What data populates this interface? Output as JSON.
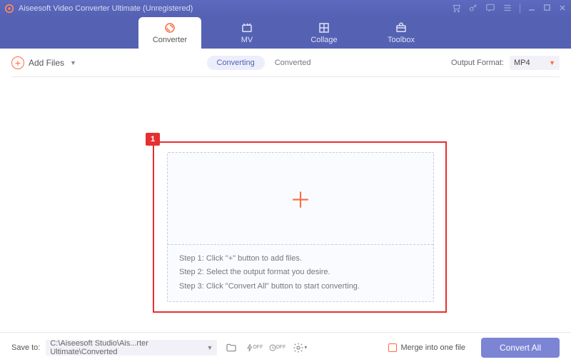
{
  "titlebar": {
    "title": "Aiseesoft Video Converter Ultimate (Unregistered)"
  },
  "nav": {
    "tabs": [
      {
        "label": "Converter"
      },
      {
        "label": "MV"
      },
      {
        "label": "Collage"
      },
      {
        "label": "Toolbox"
      }
    ]
  },
  "toolbar": {
    "add_files": "Add Files",
    "seg_converting": "Converting",
    "seg_converted": "Converted",
    "output_label": "Output Format:",
    "output_value": "MP4"
  },
  "annotation": {
    "label": "1"
  },
  "dropzone": {
    "step1": "Step 1: Click \"+\" button to add files.",
    "step2": "Step 2: Select the output format you desire.",
    "step3": "Step 3: Click \"Convert All\" button to start converting."
  },
  "footer": {
    "save_to_label": "Save to:",
    "save_to_path": "C:\\Aiseesoft Studio\\Ais...rter Ultimate\\Converted",
    "merge_label": "Merge into one file",
    "convert_label": "Convert All"
  }
}
